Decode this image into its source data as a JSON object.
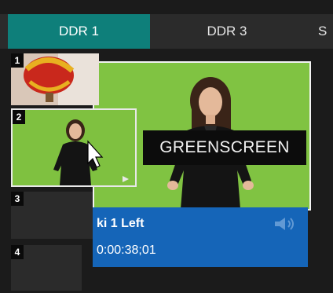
{
  "tabs": [
    {
      "label": "DDR 1",
      "active": true
    },
    {
      "label": "DDR 3",
      "active": false
    },
    {
      "label": "S",
      "active": false
    }
  ],
  "preview": {
    "overlay_label": "GREENSCREEN",
    "clip_name": "ki 1 Left",
    "timecode": "0:00:38;01",
    "audio_icon": "speaker-icon"
  },
  "slots": [
    {
      "number": "1",
      "thumbnail": "balloon"
    },
    {
      "number": "2",
      "thumbnail": "greenscreen",
      "selected": true
    },
    {
      "number": "3",
      "thumbnail": "empty"
    },
    {
      "number": "4",
      "thumbnail": "empty"
    }
  ],
  "colors": {
    "active_tab": "#0e7f7a",
    "info_bar": "#1565b8",
    "green_screen": "#7fc140"
  }
}
